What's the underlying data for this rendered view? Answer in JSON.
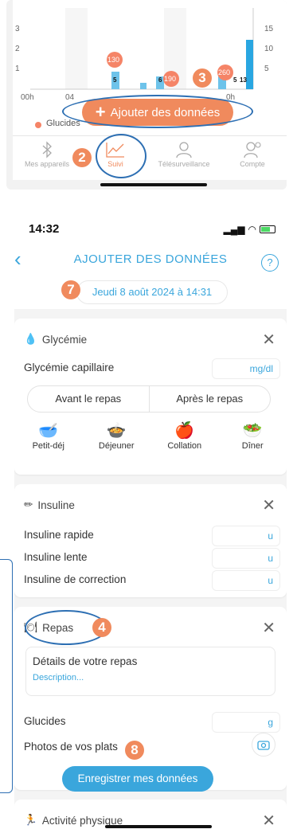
{
  "chart": {
    "left_ticks": [
      "3",
      "2",
      "1"
    ],
    "right_ticks": [
      "15",
      "10",
      "5"
    ],
    "x_labels": [
      "00h",
      "04",
      "0h"
    ],
    "bar_labels": [
      "5",
      "6",
      "5",
      "13"
    ],
    "bubble_values": [
      "130",
      "190",
      "260"
    ],
    "legend_glucides": "Glucides"
  },
  "add_button": {
    "label": "Ajouter des données"
  },
  "tabs": [
    {
      "label": "Mes appareils",
      "icon": "bluetooth-icon"
    },
    {
      "label": "Suivi",
      "icon": "chart-line-icon"
    },
    {
      "label": "Télésurveillance",
      "icon": "doctor-icon"
    },
    {
      "label": "Compte",
      "icon": "user-settings-icon"
    }
  ],
  "markers": {
    "m2": "2",
    "m3": "3",
    "m4": "4",
    "m7": "7",
    "m8": "8"
  },
  "status_bar": {
    "time": "14:32"
  },
  "nav": {
    "title": "AJOUTER DES DONNÉES",
    "back": "‹",
    "help": "?"
  },
  "date_label": "Jeudi 8 août 2024 à 14:31",
  "glycemie": {
    "title": "Glycémie",
    "capillaire_label": "Glycémie capillaire",
    "unit": "mg/dl",
    "seg_before": "Avant le repas",
    "seg_after": "Après le repas",
    "meals": [
      "Petit-déj",
      "Déjeuner",
      "Collation",
      "Dîner"
    ]
  },
  "insuline": {
    "title": "Insuline",
    "rows": [
      {
        "label": "Insuline rapide",
        "unit": "u"
      },
      {
        "label": "Insuline lente",
        "unit": "u"
      },
      {
        "label": "Insuline de correction",
        "unit": "u"
      }
    ]
  },
  "repas": {
    "title": "Repas",
    "details_label": "Détails de votre repas",
    "description_placeholder": "Description...",
    "glucides_label": "Glucides",
    "glucides_unit": "g",
    "photos_label": "Photos de vos plats"
  },
  "save_button": "Enregistrer mes données",
  "activite": {
    "title": "Activité physique"
  },
  "colors": {
    "accent": "#3aa6dc",
    "orange": "#f08a5d",
    "annotation": "#2d6fb3"
  }
}
